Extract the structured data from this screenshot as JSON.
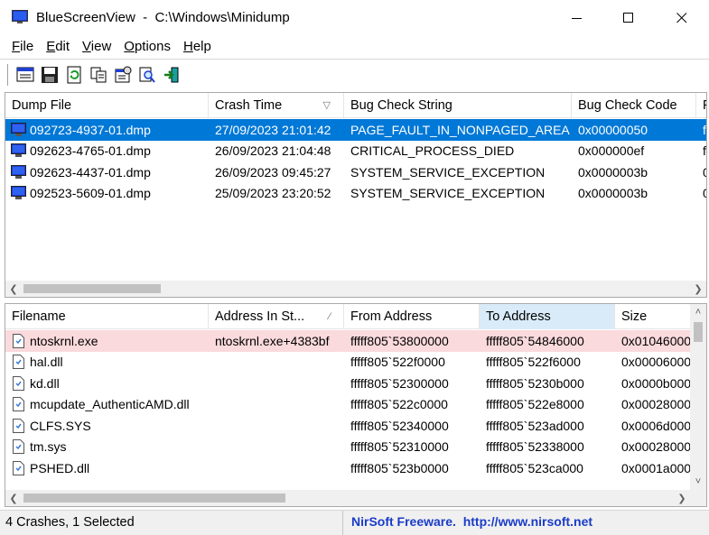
{
  "window": {
    "title": "BlueScreenView  -  C:\\Windows\\Minidump"
  },
  "menu": [
    {
      "label": "File",
      "key": "F",
      "rest": "ile"
    },
    {
      "label": "Edit",
      "key": "E",
      "rest": "dit"
    },
    {
      "label": "View",
      "key": "V",
      "rest": "iew"
    },
    {
      "label": "Options",
      "key": "O",
      "rest": "ptions"
    },
    {
      "label": "Help",
      "key": "H",
      "rest": "elp"
    }
  ],
  "toolbar": {
    "buttons": [
      "properties-view-icon",
      "save-icon",
      "refresh-icon",
      "copy-icon",
      "properties-icon",
      "find-icon",
      "exit-icon"
    ]
  },
  "dumps": {
    "columns": [
      "Dump File",
      "Crash Time",
      "Bug Check String",
      "Bug Check Code",
      "P"
    ],
    "sort_indicator": "▽",
    "rows": [
      [
        "092723-4937-01.dmp",
        "27/09/2023 21:01:42",
        "PAGE_FAULT_IN_NONPAGED_AREA",
        "0x00000050",
        "f"
      ],
      [
        "092623-4765-01.dmp",
        "26/09/2023 21:04:48",
        "CRITICAL_PROCESS_DIED",
        "0x000000ef",
        "f"
      ],
      [
        "092623-4437-01.dmp",
        "26/09/2023 09:45:27",
        "SYSTEM_SERVICE_EXCEPTION",
        "0x0000003b",
        "0"
      ],
      [
        "092523-5609-01.dmp",
        "25/09/2023 23:20:52",
        "SYSTEM_SERVICE_EXCEPTION",
        "0x0000003b",
        "0"
      ]
    ],
    "selected_row": 0
  },
  "modules": {
    "columns": [
      "Filename",
      "Address In St...",
      "From Address",
      "To Address",
      "Size"
    ],
    "sort_indicator": "∕",
    "sorted_column": 3,
    "rows": [
      [
        "ntoskrnl.exe",
        "ntoskrnl.exe+4383bf",
        "fffff805`53800000",
        "fffff805`54846000",
        "0x01046000"
      ],
      [
        "hal.dll",
        "",
        "fffff805`522f0000",
        "fffff805`522f6000",
        "0x00006000"
      ],
      [
        "kd.dll",
        "",
        "fffff805`52300000",
        "fffff805`5230b000",
        "0x0000b000"
      ],
      [
        "mcupdate_AuthenticAMD.dll",
        "",
        "fffff805`522c0000",
        "fffff805`522e8000",
        "0x00028000"
      ],
      [
        "CLFS.SYS",
        "",
        "fffff805`52340000",
        "fffff805`523ad000",
        "0x0006d000"
      ],
      [
        "tm.sys",
        "",
        "fffff805`52310000",
        "fffff805`52338000",
        "0x00028000"
      ],
      [
        "PSHED.dll",
        "",
        "fffff805`523b0000",
        "fffff805`523ca000",
        "0x0001a000"
      ]
    ],
    "highlighted_row": 0
  },
  "status": {
    "summary": "4 Crashes, 1 Selected",
    "link": "NirSoft Freeware.  http://www.nirsoft.net"
  },
  "colors": {
    "selection": "#0078d7",
    "highlight_row": "#fadadd",
    "sorted_header": "#d9ebf9",
    "link": "#1a3cc8"
  }
}
